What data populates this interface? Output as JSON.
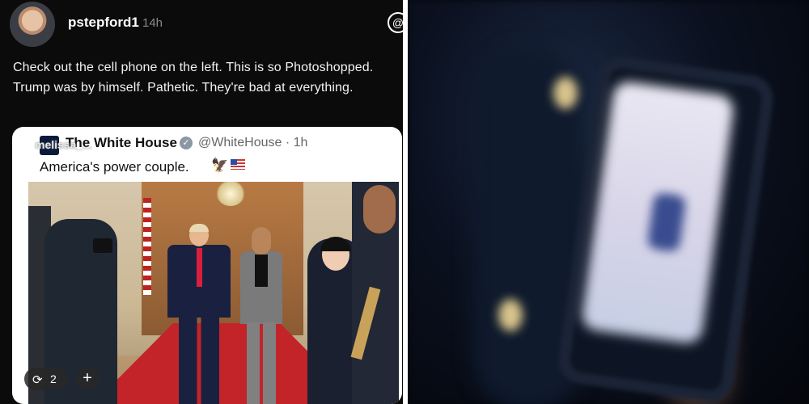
{
  "post": {
    "username": "pstepford1",
    "time": "14h",
    "text": "Check out the cell phone on the left. This is so Photoshopped. Trump was by himself. Pathetic. They're bad at everything."
  },
  "embedded_tweet": {
    "watermark": "melissa_...",
    "account_name": "The White House",
    "handle_time": "@WhiteHouse · 1h",
    "text": "America's power couple.",
    "emoji": "🦅"
  },
  "actions": {
    "repost_count": "2",
    "repost_icon": "repost-icon",
    "plus_label": "+"
  },
  "icons": {
    "threads": "@"
  },
  "colors": {
    "background": "#0b0b0b",
    "card": "#ffffff",
    "carpet": "#c22429",
    "tie": "#d91f3c"
  }
}
